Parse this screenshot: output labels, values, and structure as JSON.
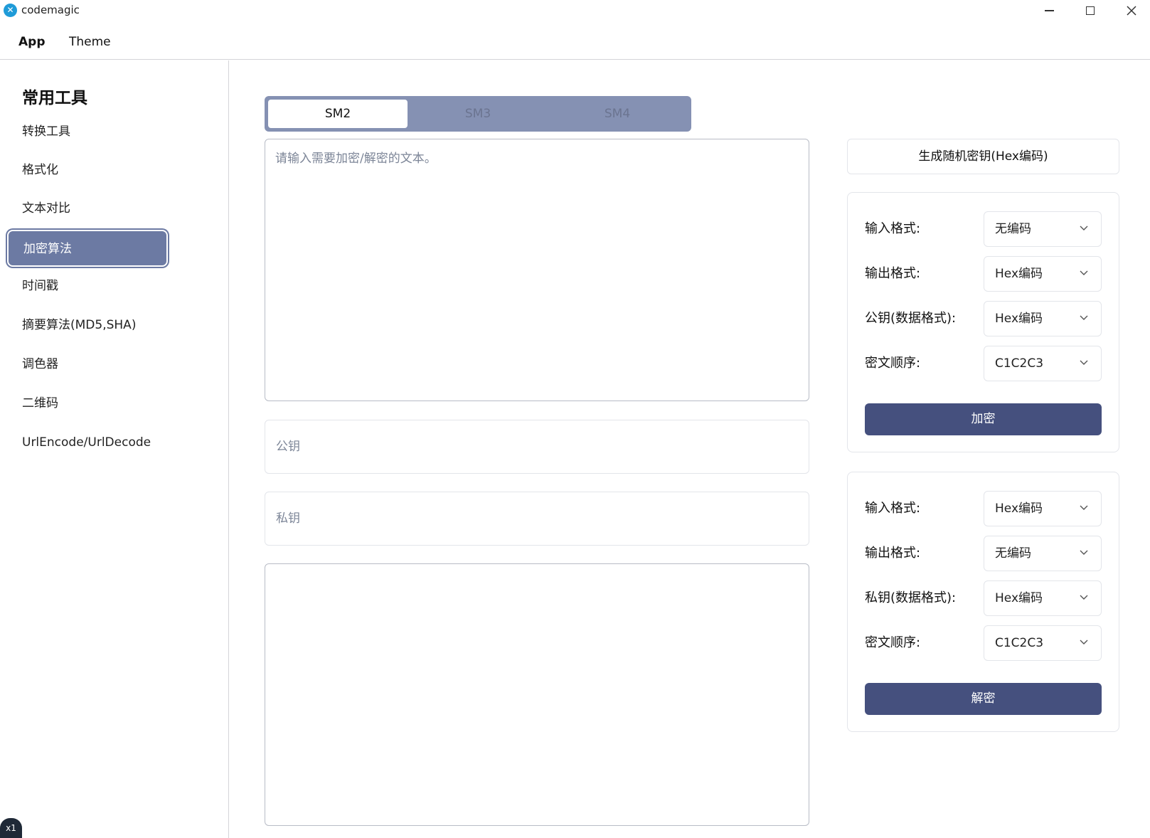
{
  "window": {
    "title": "codemagic",
    "logo_glyph": "✕",
    "controls": [
      "minimize-icon",
      "maximize-icon",
      "close-icon"
    ]
  },
  "menubar": {
    "app_label": "App",
    "theme_label": "Theme"
  },
  "sidebar": {
    "title": "常用工具",
    "items": [
      {
        "label": "转换工具",
        "active": false
      },
      {
        "label": "格式化",
        "active": false
      },
      {
        "label": "文本对比",
        "active": false
      },
      {
        "label": "加密算法",
        "active": true
      },
      {
        "label": "时间戳",
        "active": false
      },
      {
        "label": "摘要算法(MD5,SHA)",
        "active": false
      },
      {
        "label": "调色器",
        "active": false
      },
      {
        "label": "二维码",
        "active": false
      },
      {
        "label": "UrlEncode/UrlDecode",
        "active": false
      }
    ],
    "badge": "x1"
  },
  "tabs": {
    "items": [
      "SM2",
      "SM3",
      "SM4"
    ],
    "selected": "SM2"
  },
  "main": {
    "input_placeholder": "请输入需要加密/解密的文本。",
    "public_key_placeholder": "公钥",
    "private_key_placeholder": "私钥",
    "output_value": ""
  },
  "right_panel": {
    "generate_key_label": "生成随机密钥(Hex编码)",
    "encrypt": {
      "rows": [
        {
          "label": "输入格式:",
          "value": "无编码"
        },
        {
          "label": "输出格式:",
          "value": "Hex编码"
        },
        {
          "label": "公钥(数据格式):",
          "value": "Hex编码"
        },
        {
          "label": "密文顺序:",
          "value": "C1C2C3"
        }
      ],
      "button_label": "加密"
    },
    "decrypt": {
      "rows": [
        {
          "label": "输入格式:",
          "value": "Hex编码"
        },
        {
          "label": "输出格式:",
          "value": "无编码"
        },
        {
          "label": "私钥(数据格式):",
          "value": "Hex编码"
        },
        {
          "label": "密文顺序:",
          "value": "C1C2C3"
        }
      ],
      "button_label": "解密"
    }
  },
  "colors": {
    "accent": "#45507e",
    "sidebar_active": "#6c7aa3",
    "tab_bar": "#8591b3"
  }
}
